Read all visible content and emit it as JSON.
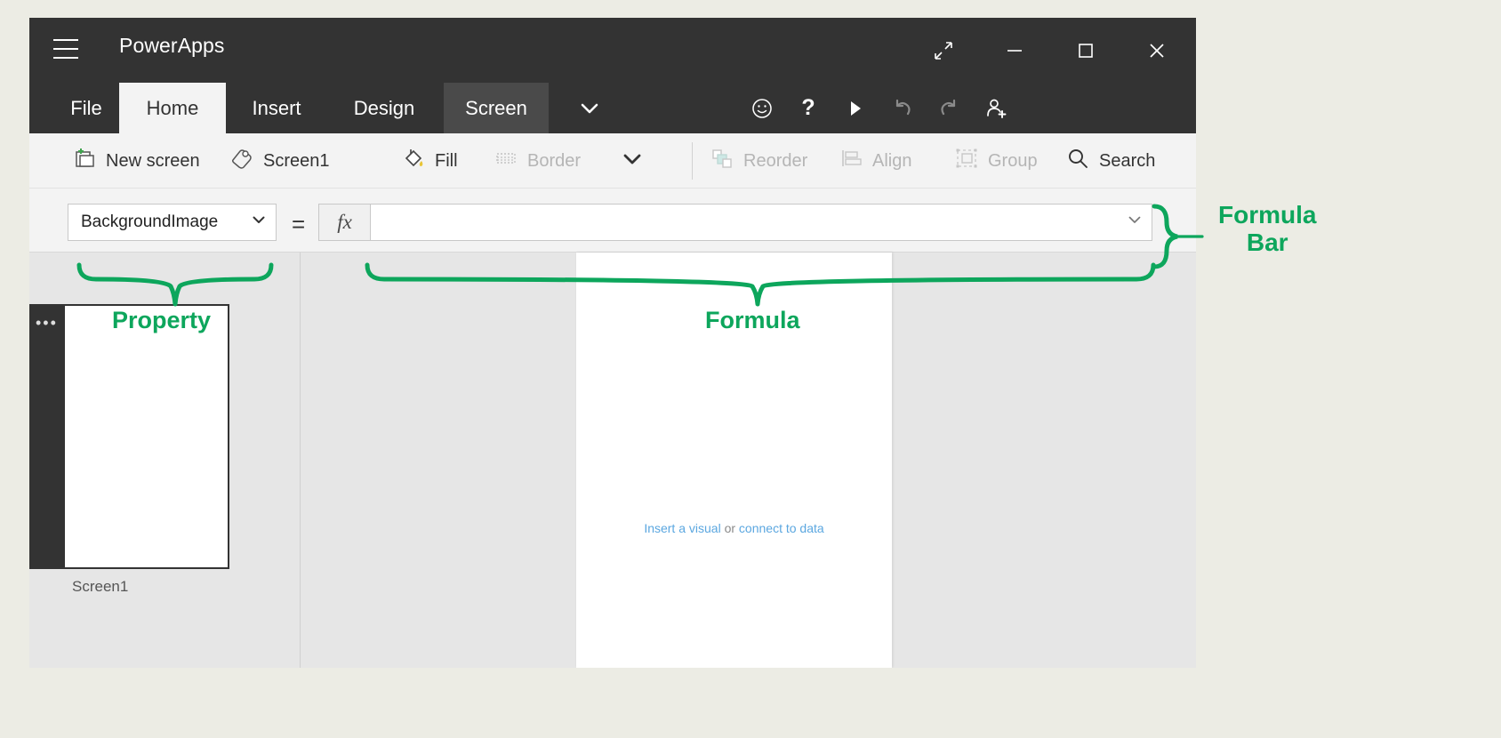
{
  "window": {
    "title": "PowerApps",
    "hamburger_icon": "hamburger-menu-icon",
    "controls": [
      {
        "name": "restore-fullscreen-button",
        "icon": "diagonal-arrows-icon",
        "label": "↗"
      },
      {
        "name": "minimize-button",
        "icon": "minimize-icon",
        "label": "—"
      },
      {
        "name": "maximize-button",
        "icon": "maximize-icon",
        "label": "☐"
      },
      {
        "name": "close-button",
        "icon": "close-x-icon",
        "label": "✕"
      }
    ]
  },
  "tabs": [
    {
      "label": "File",
      "active": false,
      "hovered": false
    },
    {
      "label": "Home",
      "active": true,
      "hovered": false
    },
    {
      "label": "Insert",
      "active": false,
      "hovered": false
    },
    {
      "label": "Design",
      "active": false,
      "hovered": false
    },
    {
      "label": "Screen",
      "active": false,
      "hovered": true
    }
  ],
  "tab_expand": {
    "name": "tabs-expand-chevron",
    "icon": "chevron-down-icon"
  },
  "quick_actions": [
    {
      "name": "feedback-smiley-button",
      "icon": "smiley-icon",
      "disabled": false
    },
    {
      "name": "help-button",
      "icon": "question-mark-icon",
      "label": "?",
      "disabled": false
    },
    {
      "name": "play-preview-button",
      "icon": "play-triangle-icon",
      "disabled": false
    },
    {
      "name": "undo-button",
      "icon": "undo-arrow-icon",
      "disabled": true
    },
    {
      "name": "redo-button",
      "icon": "redo-arrow-icon",
      "disabled": true
    },
    {
      "name": "share-add-user-button",
      "icon": "person-plus-icon",
      "disabled": false
    }
  ],
  "ribbon": {
    "commands": [
      {
        "label": "New screen",
        "icon": "new-screen-icon",
        "disabled": false
      },
      {
        "label": "Screen1",
        "icon": "tag-icon",
        "disabled": false
      },
      {
        "label": "Fill",
        "icon": "paint-bucket-icon",
        "disabled": false
      },
      {
        "label": "Border",
        "icon": "border-dashed-icon",
        "disabled": true
      },
      {
        "label": "",
        "icon": "chevron-down-icon",
        "disabled": false
      },
      {
        "label": "Reorder",
        "icon": "reorder-squares-icon",
        "disabled": true
      },
      {
        "label": "Align",
        "icon": "align-icon",
        "disabled": true
      },
      {
        "label": "Group",
        "icon": "group-icon",
        "disabled": true
      },
      {
        "label": "Search",
        "icon": "search-magnifier-icon",
        "disabled": false
      }
    ]
  },
  "formula_bar": {
    "property_selected": "BackgroundImage",
    "property_dropdown_icon": "chevron-down-icon",
    "equals": "=",
    "fx_label": "fx",
    "formula_value": "",
    "formula_placeholder": "",
    "formula_dropdown_icon": "chevron-down-icon"
  },
  "left_pane": {
    "screen_thumbnail_label": "Screen1",
    "rail_more_icon": "ellipsis-more-icon",
    "rail_more_label": "•••"
  },
  "canvas": {
    "hint_link_1": "Insert a visual",
    "hint_middle": " or ",
    "hint_link_2": "connect to data"
  },
  "annotations": {
    "formula_bar": "Formula\nBar",
    "property": "Property",
    "formula": "Formula",
    "color": "#0DA65C"
  }
}
